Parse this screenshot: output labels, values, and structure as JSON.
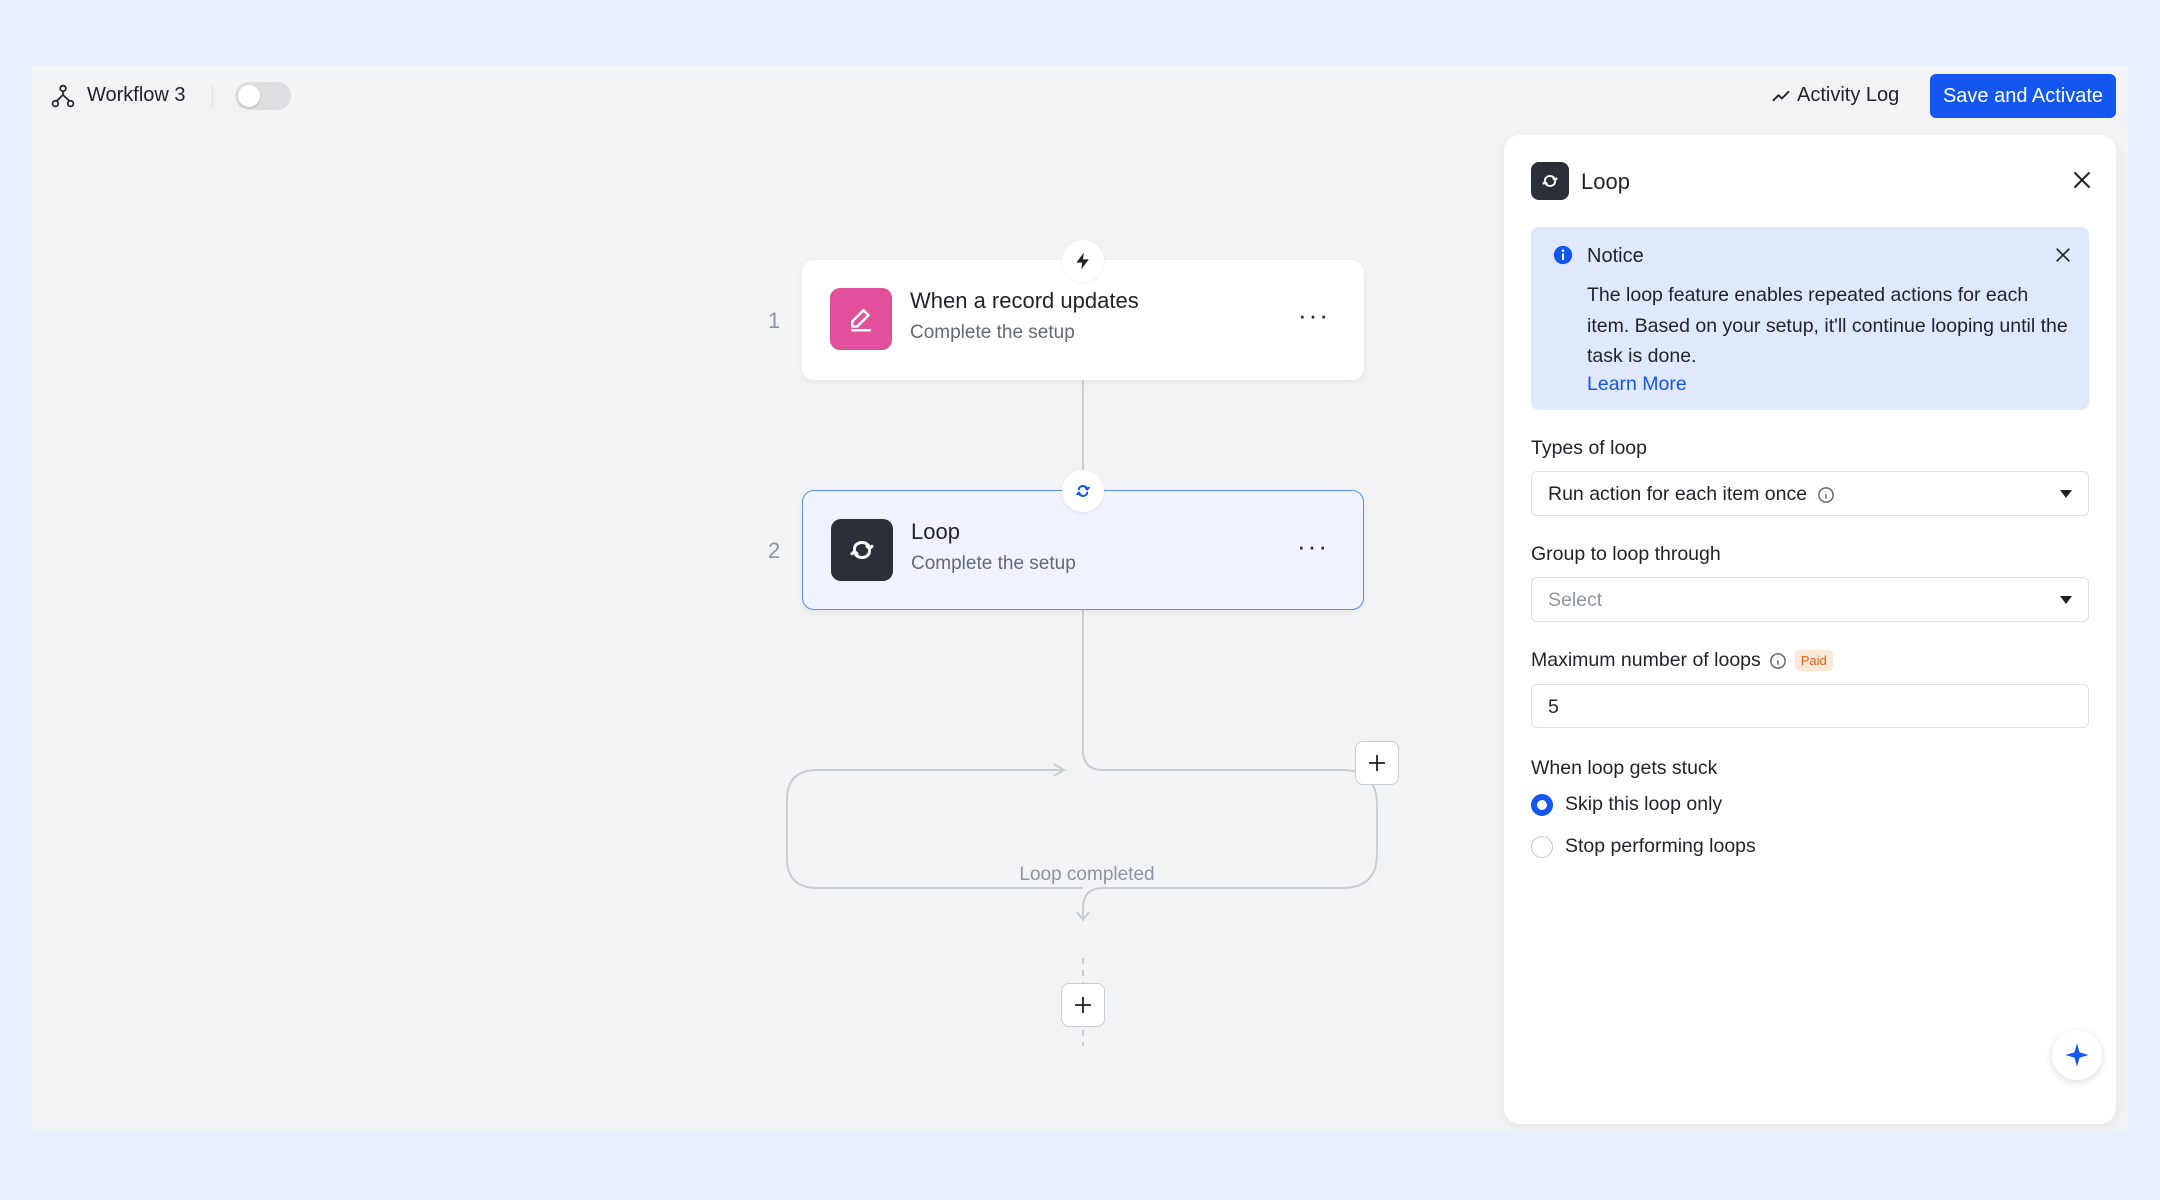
{
  "header": {
    "workflow_title": "Workflow 3",
    "toggle_on": false,
    "activity_log_label": "Activity Log",
    "save_button_label": "Save and Activate"
  },
  "canvas": {
    "steps": [
      {
        "number": "1",
        "title": "When a record updates",
        "subtitle": "Complete the setup",
        "icon": "edit-icon",
        "icon_color": "#e24f9b"
      },
      {
        "number": "2",
        "title": "Loop",
        "subtitle": "Complete the setup",
        "icon": "loop-icon",
        "icon_color": "#2b2f36"
      }
    ],
    "loop_completed_label": "Loop completed"
  },
  "panel": {
    "title": "Loop",
    "notice": {
      "title": "Notice",
      "text": "The loop feature enables repeated actions for each item. Based on your setup, it'll continue looping until the task is done.",
      "link": "Learn More"
    },
    "types_of_loop": {
      "label": "Types of loop",
      "value": "Run action for each item once"
    },
    "group_to_loop": {
      "label": "Group to loop through",
      "placeholder": "Select"
    },
    "max_loops": {
      "label": "Maximum number of loops",
      "badge": "Paid",
      "value": "5"
    },
    "stuck": {
      "label": "When loop gets stuck",
      "options": [
        {
          "label": "Skip this loop only",
          "checked": true
        },
        {
          "label": "Stop performing loops",
          "checked": false
        }
      ]
    }
  },
  "colors": {
    "primary": "#1456f0",
    "trigger_pink": "#e24f9b",
    "notice_bg": "#dfe8fd",
    "active_border": "#5b8ff9"
  }
}
